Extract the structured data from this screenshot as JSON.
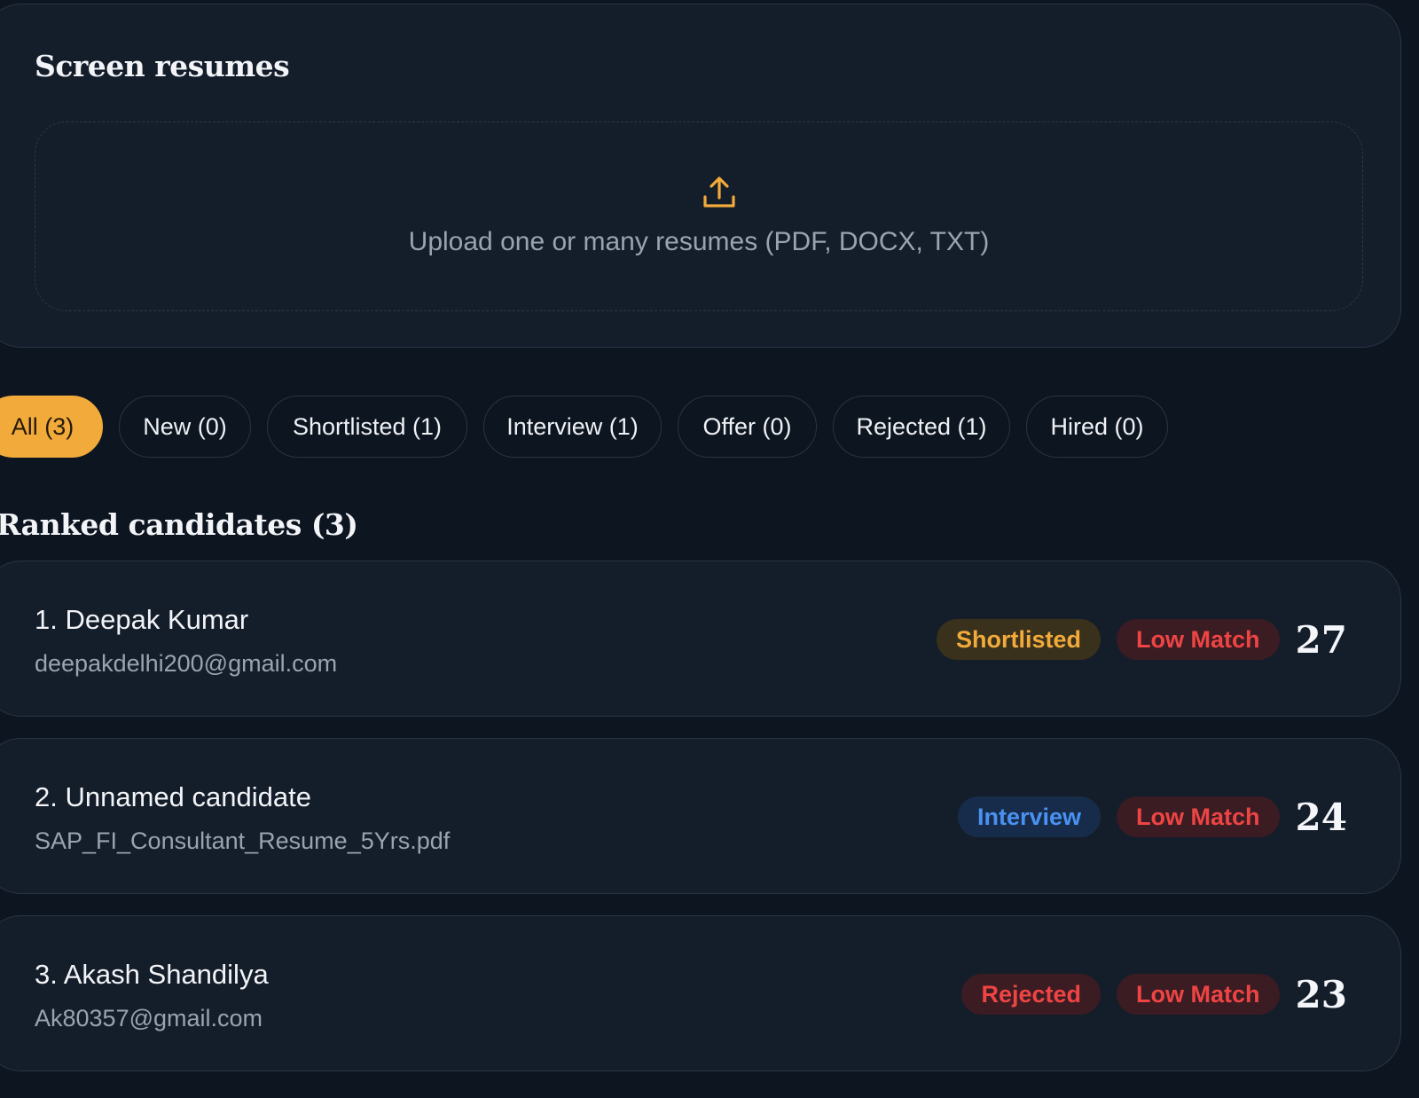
{
  "upload": {
    "title": "Screen resumes",
    "icon": "upload-icon",
    "text": "Upload one or many resumes (PDF, DOCX, TXT)",
    "accent": "#f2ab3b"
  },
  "tabs": [
    {
      "label": "All (3)",
      "active": true
    },
    {
      "label": "New (0)",
      "active": false
    },
    {
      "label": "Shortlisted (1)",
      "active": false
    },
    {
      "label": "Interview (1)",
      "active": false
    },
    {
      "label": "Offer (0)",
      "active": false
    },
    {
      "label": "Rejected (1)",
      "active": false
    },
    {
      "label": "Hired (0)",
      "active": false
    }
  ],
  "ranked": {
    "title": "Ranked candidates (3)",
    "candidates": [
      {
        "name": "1. Deepak Kumar",
        "sub": "deepakdelhi200@gmail.com",
        "status": "Shortlisted",
        "match": "Low Match",
        "score": "27"
      },
      {
        "name": "2. Unnamed candidate",
        "sub": "SAP_FI_Consultant_Resume_5Yrs.pdf",
        "status": "Interview",
        "match": "Low Match",
        "score": "24"
      },
      {
        "name": "3. Akash Shandilya",
        "sub": "Ak80357@gmail.com",
        "status": "Rejected",
        "match": "Low Match",
        "score": "23"
      }
    ]
  },
  "colors": {
    "background": "#0d1520",
    "card": "#141d2a",
    "shortlisted": "#f2ab3b",
    "interview": "#4a92f2",
    "rejected": "#ef4444"
  }
}
